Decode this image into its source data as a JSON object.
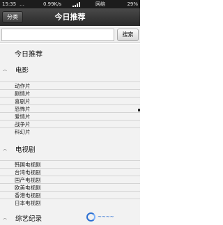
{
  "status_bar": {
    "time": "15:35",
    "notif_dots": "…",
    "speed": "0.99K/s",
    "network": "网络",
    "battery": "29%"
  },
  "header": {
    "category_button": "分类",
    "title": "今日推荐"
  },
  "search": {
    "value": "",
    "placeholder": "",
    "button": "搜索"
  },
  "list": {
    "top_item": "今日推荐",
    "sections": [
      {
        "label": "电影",
        "items": [
          "动作片",
          "剧情片",
          "喜剧片",
          "恐怖片",
          "爱情片",
          "战争片",
          "科幻片"
        ]
      },
      {
        "label": "电视剧",
        "items": [
          "韩国电视剧",
          "台湾电视剧",
          "国产电视剧",
          "欧美电视剧",
          "香港电视剧",
          "日本电视剧"
        ]
      },
      {
        "label": "综艺纪录",
        "items": []
      }
    ]
  },
  "icons": {
    "section_chevron": "chevron-up-icon",
    "signal": "signal-icon",
    "battery": "battery-icon"
  },
  "colors": {
    "titlebar": "#2f2f2f",
    "list_bg": "#f2f2f2",
    "watermark_blue": "#2b6fd1"
  }
}
